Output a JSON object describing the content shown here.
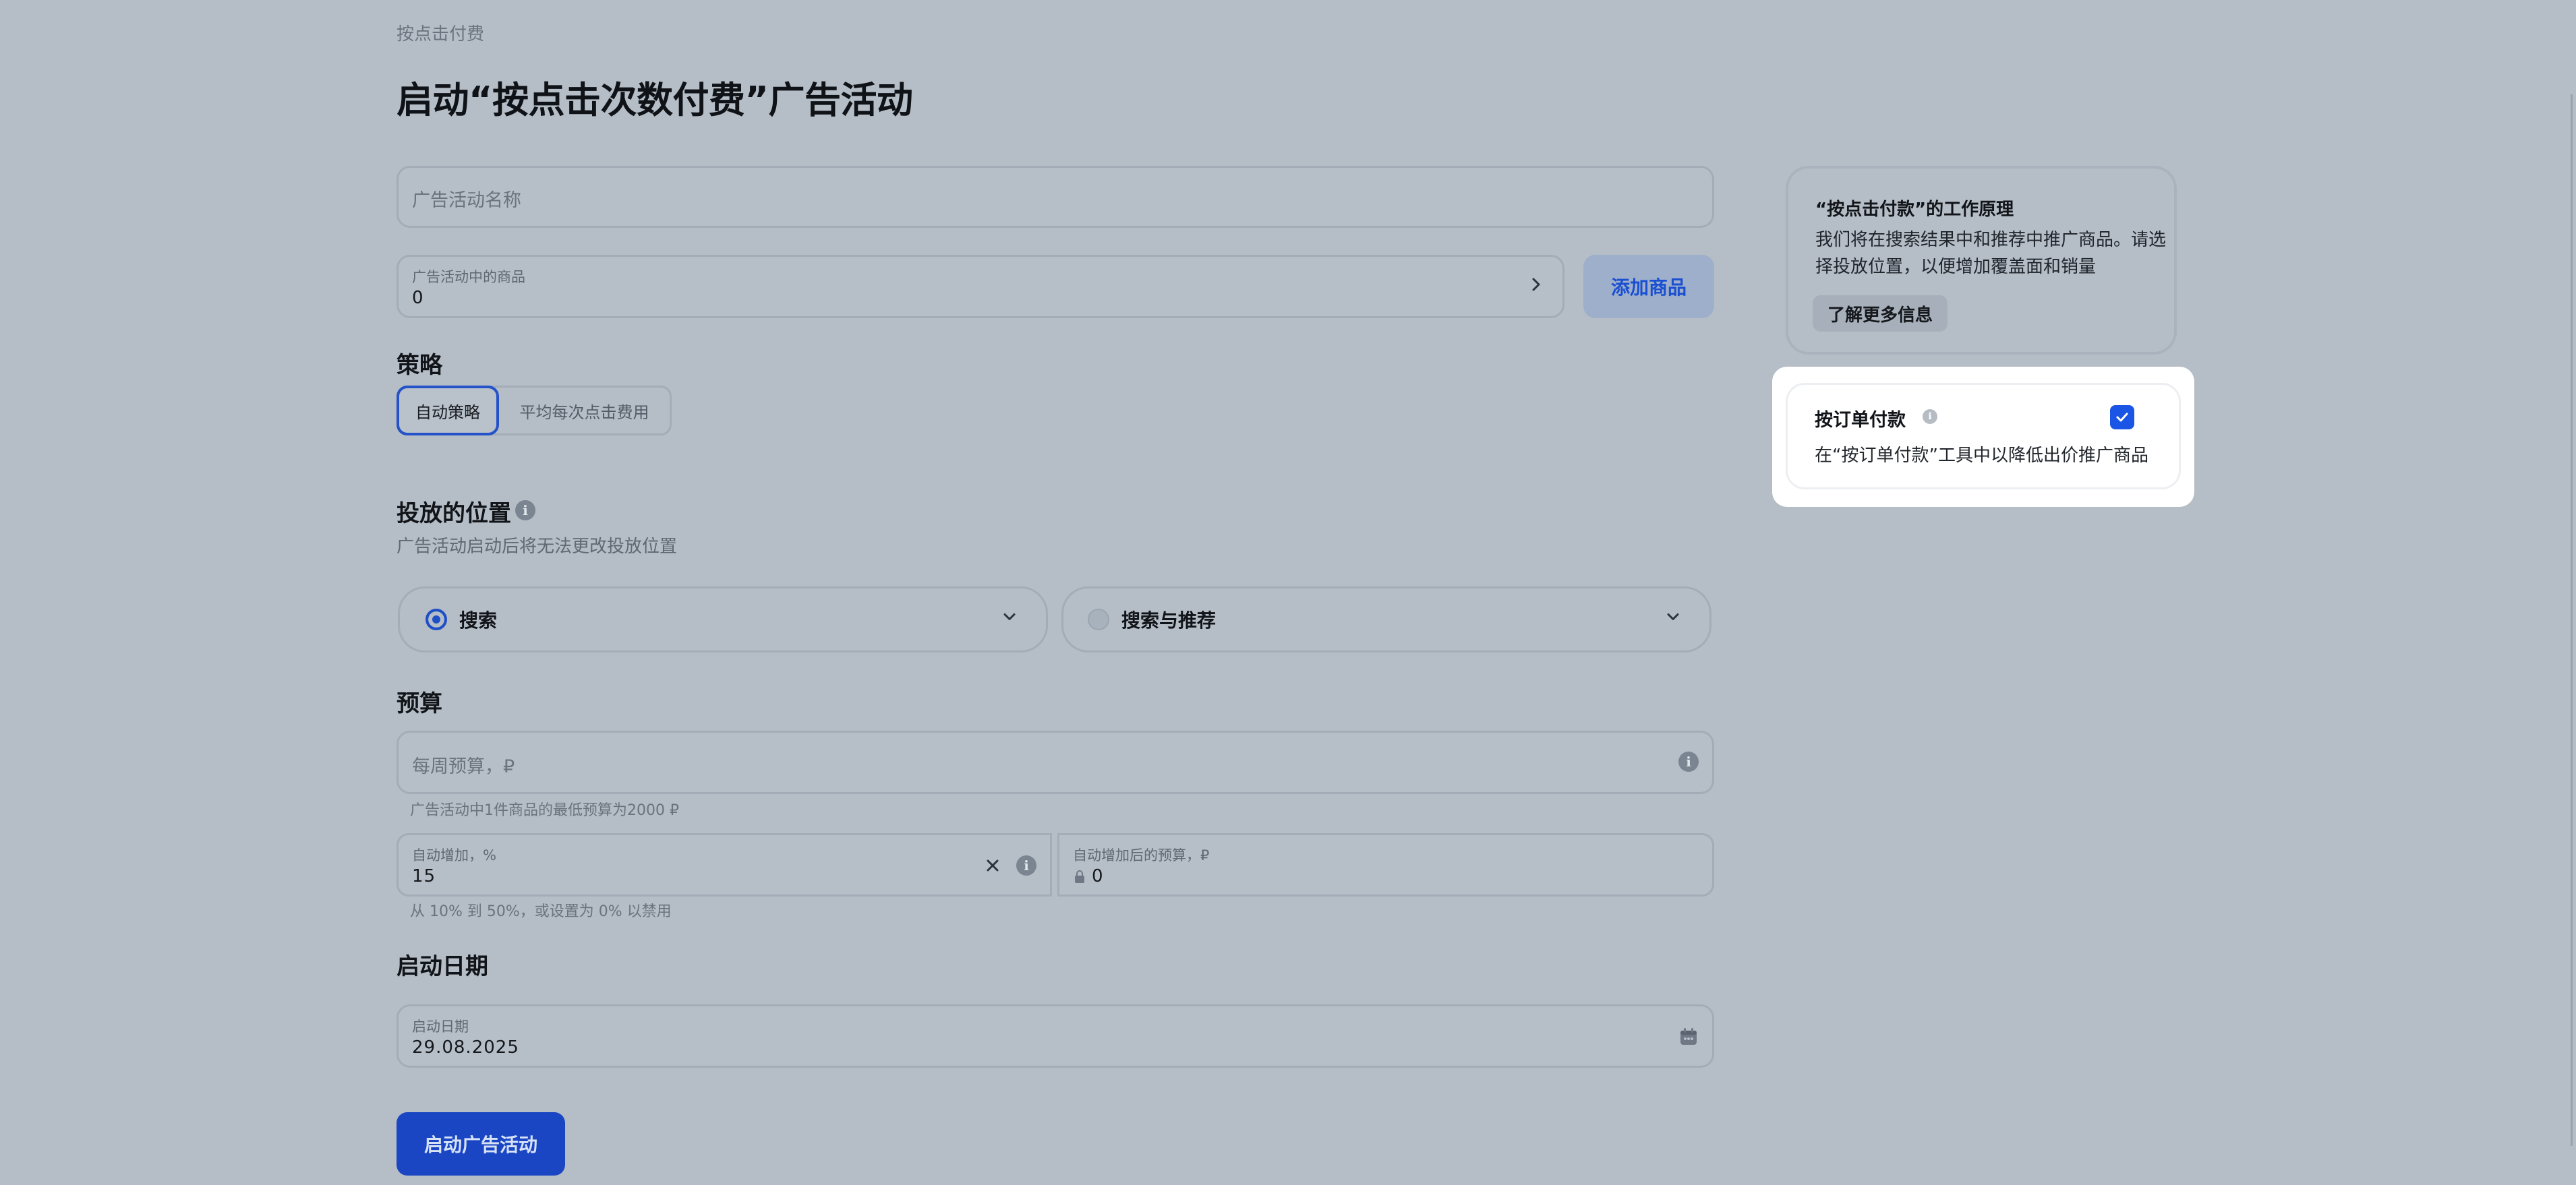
{
  "header": {
    "breadcrumb": "按点击付费",
    "title": "启动“按点击次数付费”广告活动"
  },
  "form": {
    "campaign_name": {
      "placeholder": "广告活动名称",
      "value": ""
    },
    "products": {
      "label": "广告活动中的商品",
      "value": "0",
      "add_button": "添加商品"
    },
    "strategy": {
      "title": "策略",
      "options": [
        "自动策略",
        "平均每次点击费用"
      ],
      "selected": "自动策略"
    },
    "placement": {
      "title": "投放的位置",
      "subtitle": "广告活动启动后将无法更改投放位置",
      "options": [
        {
          "label": "搜索",
          "selected": true
        },
        {
          "label": "搜索与推荐",
          "selected": false
        }
      ]
    },
    "budget": {
      "title": "预算",
      "weekly_placeholder": "每周预算，₽",
      "min_hint": "广告活动中1件商品的最低预算为2000 ₽",
      "auto_increase": {
        "label": "自动增加，%",
        "value": "15"
      },
      "after_increase": {
        "label": "自动增加后的预算，₽",
        "value": "0"
      },
      "range_hint": "从 10% 到 50%，或设置为 0% 以禁用"
    },
    "start_date": {
      "title": "启动日期",
      "label": "启动日期",
      "value": "29.08.2025"
    },
    "launch_button": "启动广告活动"
  },
  "sidebar": {
    "info_card": {
      "title": "“按点击付款”的工作原理",
      "body": "我们将在搜索结果中和推荐中推广商品。请选择投放位置，以便增加覆盖面和销量",
      "more_button": "了解更多信息"
    },
    "order_card": {
      "title": "按订单付款",
      "checked": true,
      "description": "在“按订单付款”工具中以降低出价推广商品"
    }
  },
  "colors": {
    "accent": "#1a46c4",
    "background_dim": "#b5bdc6",
    "highlight": "#ffffff"
  },
  "icons": [
    "chevron-right-icon",
    "info-icon",
    "chevron-down-icon",
    "clear-icon",
    "lock-icon",
    "calendar-icon",
    "check-icon"
  ]
}
